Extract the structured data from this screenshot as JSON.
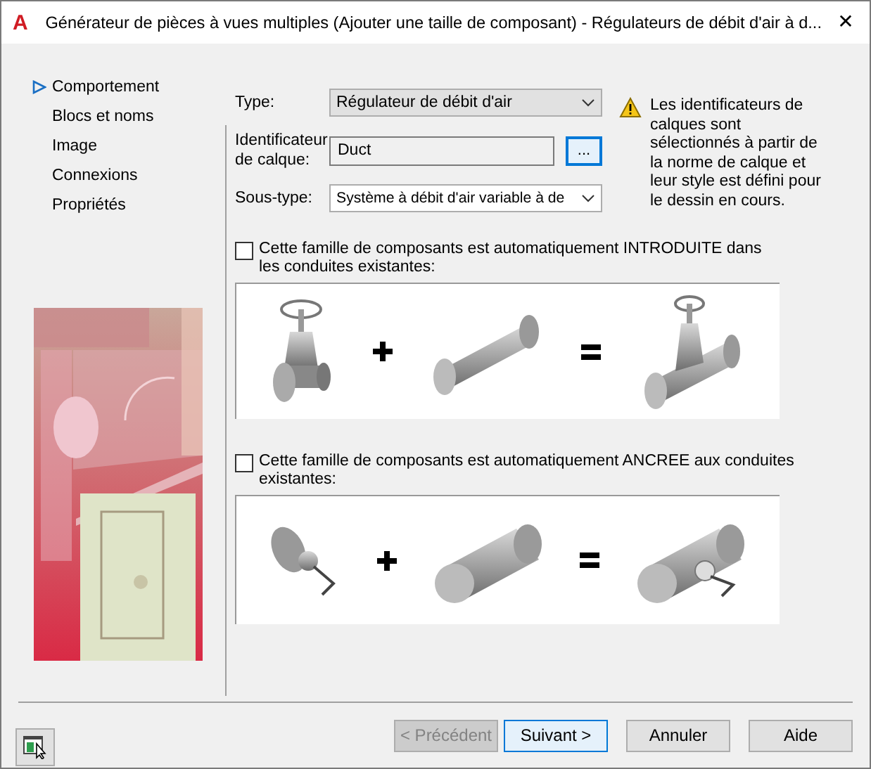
{
  "window": {
    "logo": "A",
    "title": "Générateur de pièces à vues multiples (Ajouter une taille de composant) - Régulateurs de débit d'air à d...",
    "close": "✕"
  },
  "nav": [
    {
      "label": "Comportement",
      "selected": true
    },
    {
      "label": "Blocs et noms",
      "selected": false
    },
    {
      "label": "Image",
      "selected": false
    },
    {
      "label": "Connexions",
      "selected": false
    },
    {
      "label": "Propriétés",
      "selected": false
    }
  ],
  "form": {
    "type": {
      "label": "Type:",
      "value": "Régulateur de débit d'air"
    },
    "layer": {
      "label": "Identificateur de calque:",
      "value": "Duct",
      "browse": "..."
    },
    "subtype": {
      "label": "Sous-type:",
      "value": "Système à débit d'air variable à de"
    },
    "note": "Les identificateurs de calques sont sélectionnés à partir de la norme de calque et leur style est défini pour le dessin en cours."
  },
  "options": [
    {
      "kind": "inserted",
      "label": "Cette famille de composants est automatiquement INTRODUITE dans les conduites existantes:",
      "checked": false
    },
    {
      "kind": "anchored",
      "label": "Cette famille de composants est automatiquement ANCREE aux conduites existantes:",
      "checked": false
    }
  ],
  "buttons": [
    {
      "label": "< Précédent",
      "disabled": true,
      "default": false
    },
    {
      "label": "Suivant >",
      "disabled": false,
      "default": true
    },
    {
      "label": "Annuler",
      "disabled": false,
      "default": false
    },
    {
      "label": "Aide",
      "disabled": false,
      "default": false
    }
  ]
}
